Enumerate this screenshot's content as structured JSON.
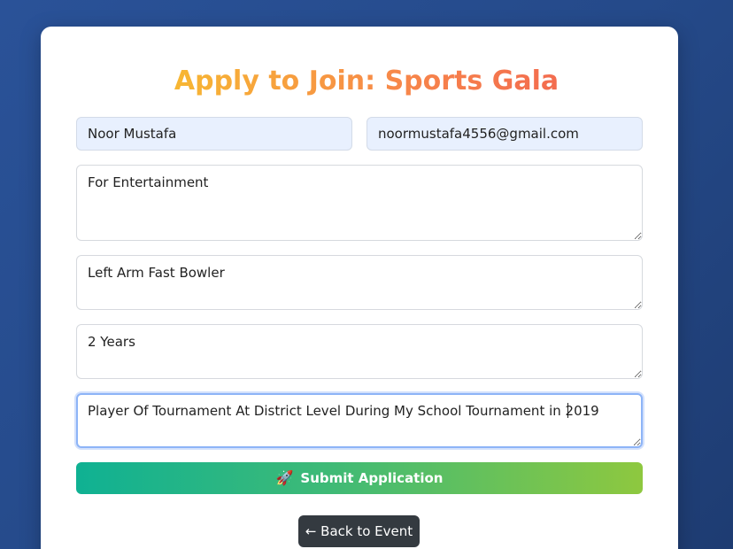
{
  "form": {
    "title": "Apply to Join: Sports Gala",
    "name_value": "Noor Mustafa",
    "email_value": "noormustafa4556@gmail.com",
    "reason_value": "For Entertainment",
    "role_value": "Left Arm Fast Bowler",
    "experience_value": "2 Years",
    "achievements_value": "Player Of Tournament At District Level During My School Tournament in 2019",
    "submit_label": "Submit Application",
    "submit_icon": "rocket-icon",
    "back_label": "← Back to Event"
  },
  "colors": {
    "title_gradient": [
      "#f7b733",
      "#f36c4f"
    ],
    "submit_gradient": [
      "#0fb193",
      "#8ec83f"
    ],
    "back_button": "#343a40",
    "page_background": "#2a5298"
  }
}
